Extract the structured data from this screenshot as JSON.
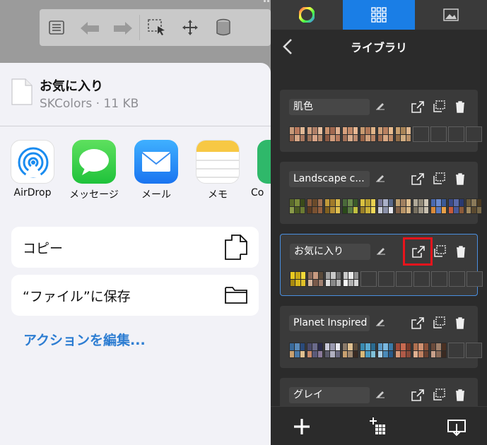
{
  "share_sheet": {
    "file_name": "お気に入り",
    "file_info": "SKColors · 11 KB",
    "apps": [
      {
        "label": "AirDrop",
        "icon": "airdrop-icon"
      },
      {
        "label": "メッセージ",
        "icon": "messages-icon"
      },
      {
        "label": "メール",
        "icon": "mail-icon"
      },
      {
        "label": "メモ",
        "icon": "notes-icon"
      },
      {
        "label": "Co",
        "icon": "app-icon"
      }
    ],
    "actions": [
      {
        "label": "コピー",
        "icon": "copy-icon"
      },
      {
        "label": "“ファイル”に保存",
        "icon": "folder-icon"
      }
    ],
    "edit_actions": "アクションを編集..."
  },
  "panel": {
    "title": "ライブラリ",
    "tabs": [
      "color-wheel-icon",
      "swatch-grid-icon",
      "image-icon"
    ],
    "libraries": [
      {
        "name": "肌色",
        "selected": false,
        "palettes": [
          [
            "#c89a7a",
            "#b97a5e",
            "#e0b896",
            "#9c6a52",
            "#d8a888",
            "#a87860"
          ],
          [
            "#d0a080",
            "#b08068",
            "#e8c0a0",
            "#9a7058",
            "#d8a488",
            "#b88a6c"
          ],
          [
            "#c8906c",
            "#a06850",
            "#e0b090",
            "#8c5a44",
            "#d09c7c",
            "#b87c60"
          ],
          [
            "#d8a07c",
            "#c08868",
            "#e8b894",
            "#a07058",
            "#d8ac8c",
            "#bc8c70"
          ],
          [
            "#c89a70",
            "#b07858",
            "#e0b488",
            "#986448",
            "#d0a07c",
            "#b88464"
          ],
          [
            "#d0a078",
            "#b88060",
            "#e8bc90",
            "#a06c50",
            "#d8a884",
            "#c08c68"
          ],
          [
            "#c8a070",
            "#a88458",
            "#e0b890",
            "#906c48",
            "#d0ac80",
            "#b89068"
          ],
          null,
          null,
          null,
          null
        ]
      },
      {
        "name": "Landscape c...",
        "selected": false,
        "palettes": [
          [
            "#5a6a2a",
            "#7a8a3a",
            "#3a4a1a",
            "#8a9a4a",
            "#4a5a22",
            "#6a7a32"
          ],
          [
            "#8a5a3a",
            "#6a4a2a",
            "#a07050",
            "#5a3a22",
            "#7a5232",
            "#94603e"
          ],
          [
            "#c09a3a",
            "#a07a2a",
            "#d8b84a",
            "#806020",
            "#b89036",
            "#e0c050"
          ],
          [
            "#4a6a3a",
            "#6a8a4a",
            "#3a5a2a",
            "#2a4a1a",
            "#5a7a42",
            "#c0c040"
          ],
          [
            "#d8c040",
            "#b8a030",
            "#e8d050",
            "#9a8028",
            "#c8b038",
            "#f0d858"
          ],
          [
            "#7a7a9a",
            "#aab0c8",
            "#5a6a8a",
            "#c8ccd8",
            "#8a90a8",
            "#e8e8f0"
          ],
          [
            "#c0a070",
            "#a08060",
            "#e0c090",
            "#806048",
            "#b89468",
            "#d8b888"
          ],
          [
            "#b0a898",
            "#908878",
            "#d0c8b8",
            "#787060",
            "#a09888",
            "#c8c0b0"
          ],
          [
            "#4a6ab0",
            "#6a8ad0",
            "#3a5a98",
            "#d88a3a",
            "#5a7ac0",
            "#e8a048"
          ],
          [
            "#3a4a8a",
            "#5a6aaa",
            "#2a3a70",
            "#c85a3a",
            "#4a5a98",
            "#8a5a3a"
          ],
          [
            "#6a5a3a",
            "#8a7a5a",
            "#4a3a22",
            "#a08a60",
            "#5a4a30",
            "#7a6a48"
          ]
        ]
      },
      {
        "name": "お気に入り",
        "selected": true,
        "palettes": [
          [
            "#e8c820",
            "#c8a818",
            "#f0d838",
            "#a88a10",
            "#d8b81c",
            "#e0c028"
          ],
          [
            "#8a6a5a",
            "#c89a80",
            "#5a4a3a",
            "#d8b8a0",
            "#7a5a4a",
            "#a08070"
          ],
          [
            "#a0a0a0",
            "#c8c8c8",
            "#707070",
            "#e0e0e0",
            "#888888",
            "#b8b8b8"
          ],
          [
            "#c8c8c8",
            "#e8e8e8",
            "#909090",
            "#f8f8f8",
            "#b0b0b0",
            "#d8d8d8"
          ],
          null,
          null,
          null,
          null,
          null,
          null,
          null
        ]
      },
      {
        "name": "Planet Inspired",
        "selected": false,
        "palettes": [
          [
            "#3a6a9a",
            "#5a8aba",
            "#2a4a7a",
            "#c8a070",
            "#4a7aaa",
            "#e0c090"
          ],
          [
            "#4a4a6a",
            "#6a6a8a",
            "#2a2a4a",
            "#c88a6a",
            "#5a5a7a",
            "#8a7a9a"
          ],
          [
            "#c8c8d8",
            "#9a9ab0",
            "#e8e8f0",
            "#5a5a6a",
            "#b0b0c0",
            "#6a6a80"
          ],
          [
            "#8a7a6a",
            "#e0c090",
            "#5a4a3a",
            "#c8a070",
            "#a08870",
            "#3a2a22"
          ],
          [
            "#3a8ab0",
            "#5aaad0",
            "#2a6a90",
            "#d8b878",
            "#4a9ac0",
            "#80c0d8"
          ],
          [
            "#5a9ac8",
            "#7ab8e0",
            "#3a7aa8",
            "#a8d0e8",
            "#4a8ab8",
            "#2a5a88"
          ],
          [
            "#a04a3a",
            "#c86a50",
            "#7a3a2a",
            "#d89a7a",
            "#b05a48",
            "#8a4a3a"
          ],
          [
            "#b07050",
            "#d09070",
            "#8a5038",
            "#e0b090",
            "#c08060",
            "#6a4030"
          ],
          [
            "#6a4a3a",
            "#a0806a",
            "#4a3022",
            "#c8a08a",
            "#8a6a58",
            "#3a2a22"
          ],
          null,
          null
        ]
      },
      {
        "name": "グレイ",
        "selected": false,
        "palettes": []
      }
    ]
  },
  "colors": {
    "accent": "#1a7ee6",
    "highlight": "#e8141c",
    "link": "#2d7dd2"
  }
}
